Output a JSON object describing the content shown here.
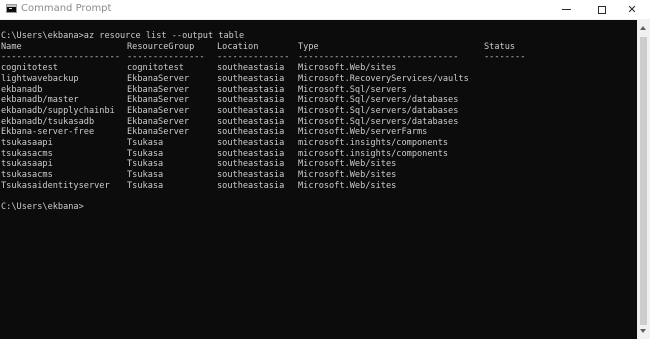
{
  "window": {
    "title": "Command Prompt",
    "icon": "cmd-icon",
    "controls": {
      "minimize": "minimize-icon",
      "maximize": "maximize-icon",
      "close": "✕"
    }
  },
  "colors": {
    "console_bg": "#0c0c0c",
    "console_fg": "#cccccc",
    "titlebar_bg": "#ffffff"
  },
  "console": {
    "command_line": "C:\\Users\\ekbana>az resource list --output table",
    "headers": {
      "name": "Name",
      "resource_group": "ResourceGroup",
      "location": "Location",
      "type": "Type",
      "status": "Status"
    },
    "separators": {
      "name": "-----------------------",
      "resource_group": "---------------",
      "location": "--------------",
      "type": "-------------------------------",
      "status": "--------"
    },
    "rows": [
      {
        "name": "cognitotest",
        "resource_group": "cognitotest",
        "location": "southeastasia",
        "type": "Microsoft.Web/sites"
      },
      {
        "name": "lightwavebackup",
        "resource_group": "EkbanaServer",
        "location": "southeastasia",
        "type": "Microsoft.RecoveryServices/vaults"
      },
      {
        "name": "ekbanadb",
        "resource_group": "EkbanaServer",
        "location": "southeastasia",
        "type": "Microsoft.Sql/servers"
      },
      {
        "name": "ekbanadb/master",
        "resource_group": "EkbanaServer",
        "location": "southeastasia",
        "type": "Microsoft.Sql/servers/databases"
      },
      {
        "name": "ekbanadb/supplychainbi",
        "resource_group": "EkbanaServer",
        "location": "southeastasia",
        "type": "Microsoft.Sql/servers/databases"
      },
      {
        "name": "ekbanadb/tsukasadb",
        "resource_group": "EkbanaServer",
        "location": "southeastasia",
        "type": "Microsoft.Sql/servers/databases"
      },
      {
        "name": "Ekbana-server-free",
        "resource_group": "EkbanaServer",
        "location": "southeastasia",
        "type": "Microsoft.Web/serverFarms"
      },
      {
        "name": "tsukasaapi",
        "resource_group": "Tsukasa",
        "location": "southeastasia",
        "type": "microsoft.insights/components"
      },
      {
        "name": "tsukasacms",
        "resource_group": "Tsukasa",
        "location": "southeastasia",
        "type": "microsoft.insights/components"
      },
      {
        "name": "tsukasaapi",
        "resource_group": "Tsukasa",
        "location": "southeastasia",
        "type": "Microsoft.Web/sites"
      },
      {
        "name": "tsukasacms",
        "resource_group": "Tsukasa",
        "location": "southeastasia",
        "type": "Microsoft.Web/sites"
      },
      {
        "name": "Tsukasaidentityserver",
        "resource_group": "Tsukasa",
        "location": "southeastasia",
        "type": "Microsoft.Web/sites"
      }
    ],
    "prompt": "C:\\Users\\ekbana>"
  }
}
